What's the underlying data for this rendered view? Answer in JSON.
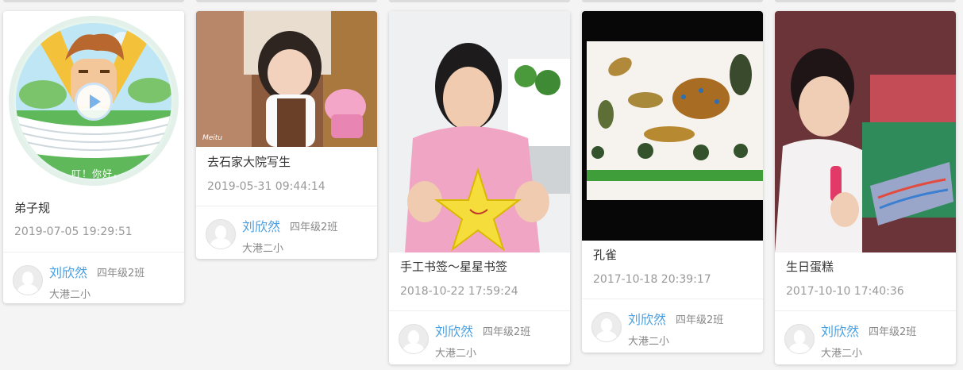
{
  "cards": [
    {
      "title": "弟子规",
      "time": "2019-07-05 19:29:51",
      "author": "刘欣然",
      "class": "四年级2班",
      "school": "大港二小",
      "bubble": "叮！你好，",
      "kind": "video"
    },
    {
      "title": "去石家大院写生",
      "time": "2019-05-31 09:44:14",
      "author": "刘欣然",
      "class": "四年级2班",
      "school": "大港二小",
      "watermark": "Meitu",
      "kind": "photo"
    },
    {
      "title": "手工书签～星星书签",
      "time": "2018-10-22 17:59:24",
      "author": "刘欣然",
      "class": "四年级2班",
      "school": "大港二小",
      "kind": "photo"
    },
    {
      "title": "孔雀",
      "time": "2017-10-18 20:39:17",
      "author": "刘欣然",
      "class": "四年级2班",
      "school": "大港二小",
      "kind": "photo"
    },
    {
      "title": "生日蛋糕",
      "time": "2017-10-10 17:40:36",
      "author": "刘欣然",
      "class": "四年级2班",
      "school": "大港二小",
      "kind": "photo"
    }
  ],
  "colors": {
    "author_link": "#4a9fe0",
    "page_bg": "#f4f4f4"
  }
}
